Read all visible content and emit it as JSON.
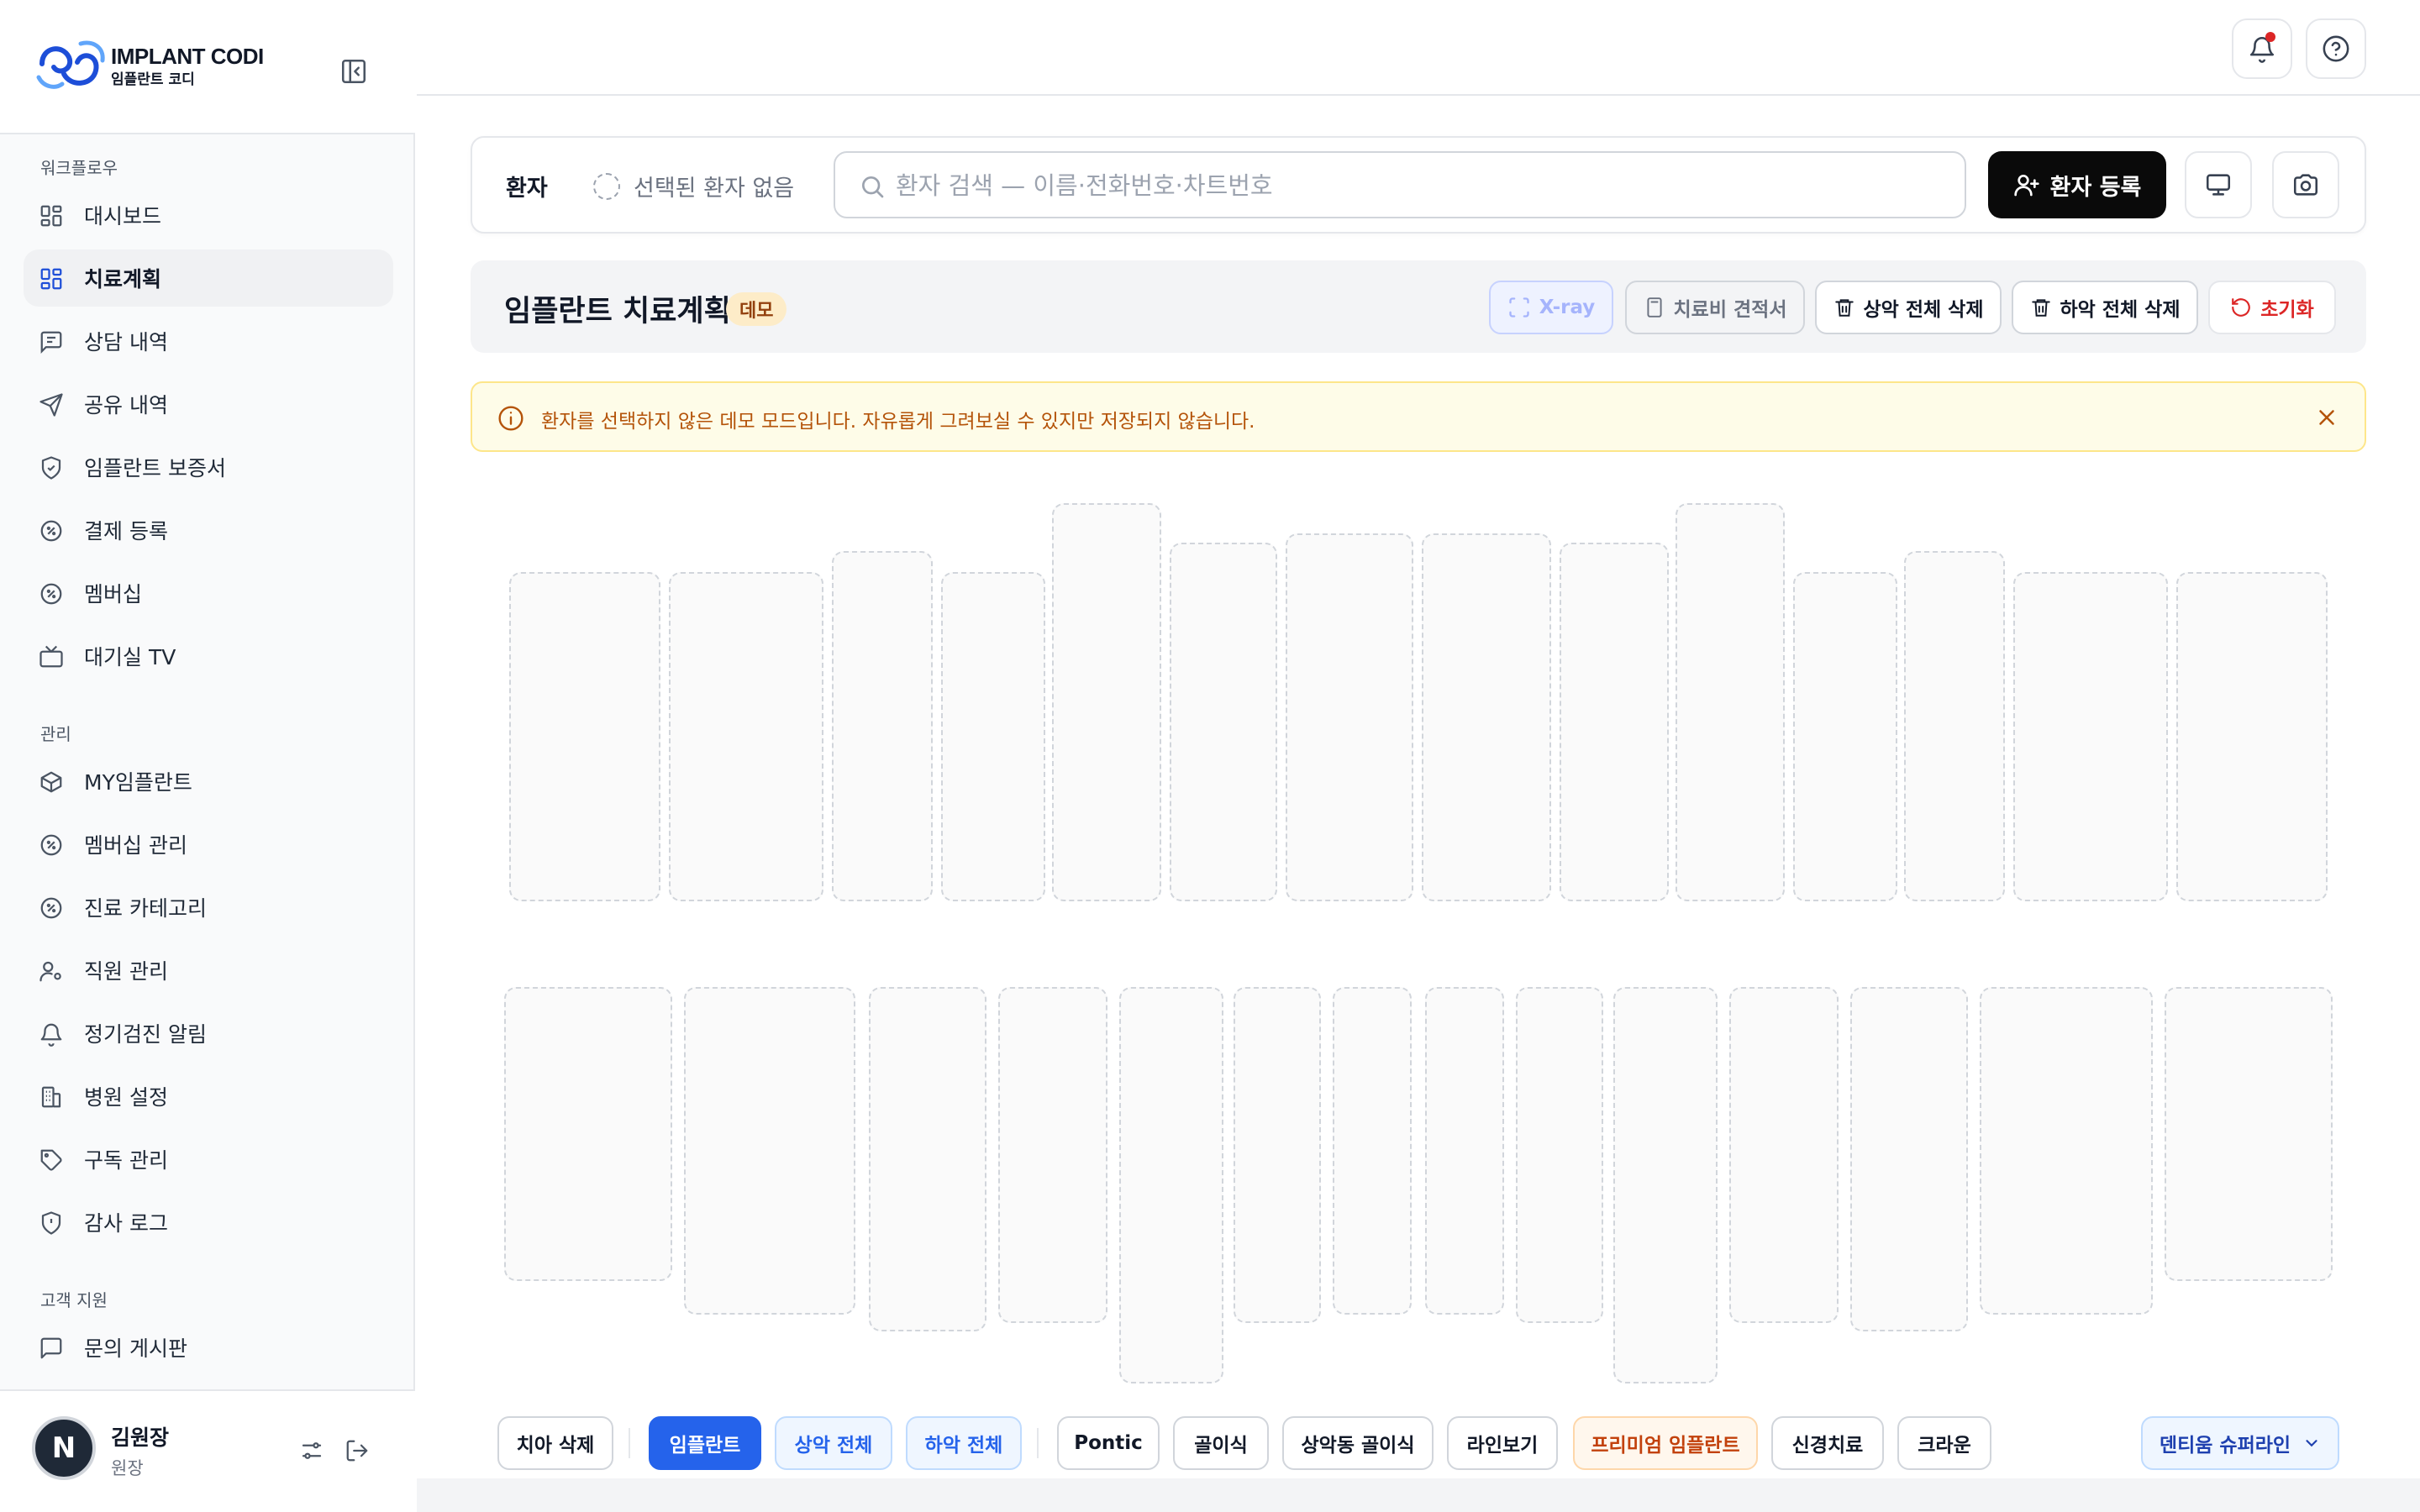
{
  "brand": {
    "title": "IMPLANT CODI",
    "subtitle": "임플란트 코디"
  },
  "sidebar": {
    "sections": [
      {
        "label": "워크플로우"
      },
      {
        "label": "관리"
      },
      {
        "label": "고객 지원"
      }
    ],
    "items": [
      {
        "label": "대시보드",
        "icon": "grid-icon"
      },
      {
        "label": "치료계획",
        "icon": "grid-icon",
        "active": true
      },
      {
        "label": "상담 내역",
        "icon": "message-icon"
      },
      {
        "label": "공유 내역",
        "icon": "send-icon"
      },
      {
        "label": "임플란트 보증서",
        "icon": "shield-icon"
      },
      {
        "label": "결제 등록",
        "icon": "badge-percent-icon"
      },
      {
        "label": "멤버십",
        "icon": "badge-percent-icon"
      },
      {
        "label": "대기실 TV",
        "icon": "tv-icon"
      },
      {
        "label": "MY임플란트",
        "icon": "box-icon"
      },
      {
        "label": "멤버십 관리",
        "icon": "badge-percent-icon"
      },
      {
        "label": "진료 카테고리",
        "icon": "badge-percent-icon"
      },
      {
        "label": "직원 관리",
        "icon": "user-cog-icon"
      },
      {
        "label": "정기검진 알림",
        "icon": "bell-icon"
      },
      {
        "label": "병원 설정",
        "icon": "building-icon"
      },
      {
        "label": "구독 관리",
        "icon": "tag-icon"
      },
      {
        "label": "감사 로그",
        "icon": "shield-alert-icon"
      },
      {
        "label": "문의 게시판",
        "icon": "message-square-icon"
      }
    ],
    "user": {
      "initial": "N",
      "name": "김원장",
      "role": "원장"
    }
  },
  "patient": {
    "label": "환자",
    "none_selected": "선택된 환자 없음",
    "search_placeholder": "환자 검색 — 이름·전화번호·차트번호",
    "register_label": "환자 등록"
  },
  "plan": {
    "title": "임플란트 치료계획",
    "badge": "데모",
    "actions": {
      "xray": "X-ray",
      "estimate": "치료비 견적서",
      "clear_upper": "상악 전체 삭제",
      "clear_lower": "하악 전체 삭제",
      "reset": "초기화"
    }
  },
  "alert": {
    "text": "환자를 선택하지 않은 데모 모드입니다. 자유롭게 그려보실 수 있지만 저장되지 않습니다."
  },
  "toolbar": {
    "delete_tooth": "치아 삭제",
    "implant": "임플란트",
    "upper_all": "상악 전체",
    "lower_all": "하악 전체",
    "pontic": "Pontic",
    "bone_graft": "골이식",
    "sinus_graft": "상악동 골이식",
    "line_view": "라인보기",
    "premium_implant": "프리미엄 임플란트",
    "root_canal": "신경치료",
    "crown": "크라운",
    "brand_select": "덴티움 슈퍼라인"
  },
  "colors": {
    "primary": "#2563eb",
    "dark": "#0a0a0a",
    "alert_bg": "#fefce8",
    "alert_text": "#b45309",
    "danger": "#dc2626"
  }
}
